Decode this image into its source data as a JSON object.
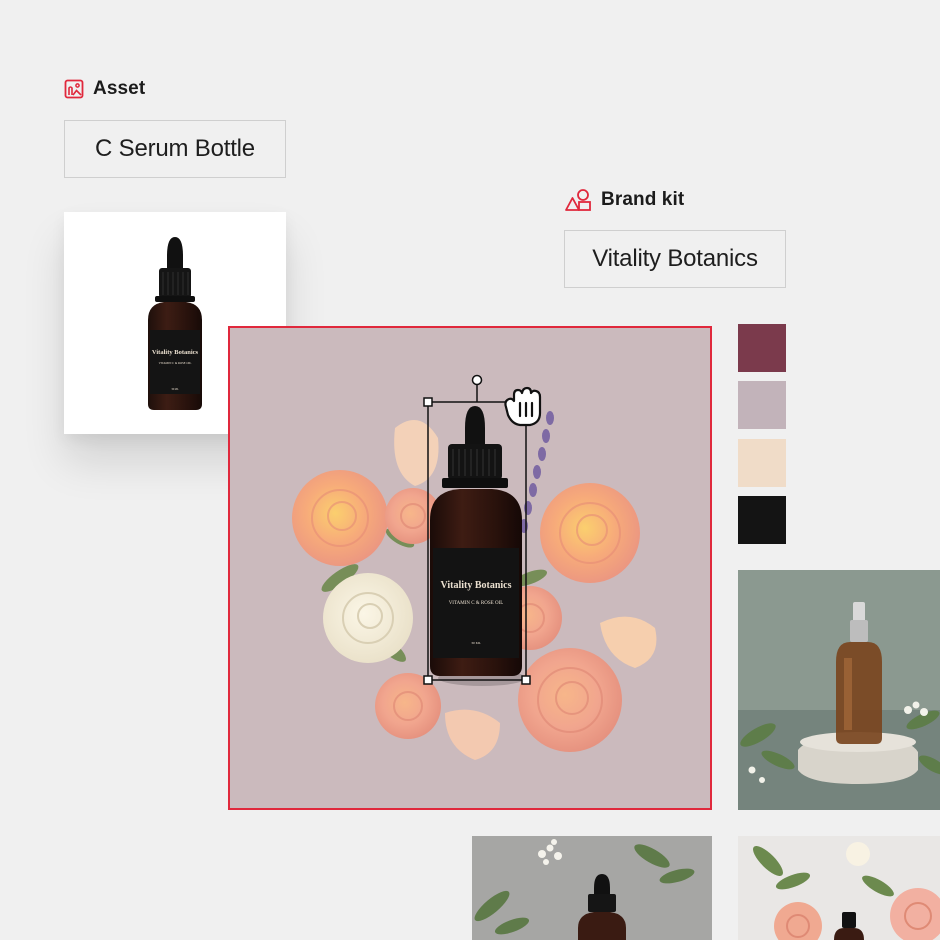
{
  "asset": {
    "section_label": "Asset",
    "section_icon": "image-icon",
    "name": "C Serum Bottle"
  },
  "brand_kit": {
    "section_label": "Brand kit",
    "section_icon": "shapes-icon",
    "name": "Vitality Botanics"
  },
  "product": {
    "brand": "Vitality Botanics",
    "subtitle": "VITAMIN C & ROSE OIL",
    "volume": "30 ML"
  },
  "palette": [
    "#7b3a4c",
    "#c2b3ba",
    "#f0dcc8",
    "#141414"
  ],
  "colors": {
    "accent": "#e0283c",
    "canvas_background": "#cbbabd",
    "page_background": "#f0f0f0"
  },
  "cursor": "grab-hand-icon"
}
